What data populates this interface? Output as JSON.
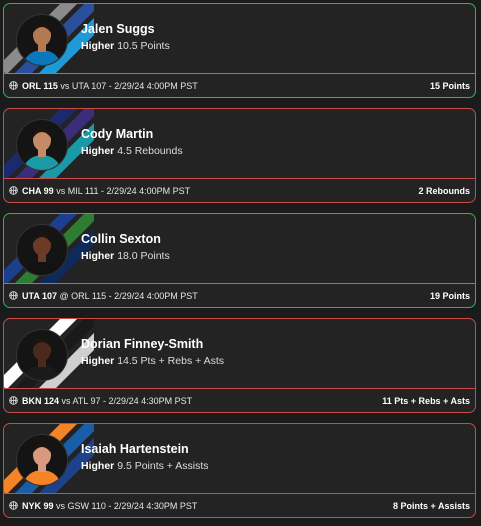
{
  "cards": [
    {
      "name": "Jalen Suggs",
      "direction": "Higher",
      "line": "10.5 Points",
      "game_team": "ORL 115",
      "game_rest": "vs UTA 107 - 2/29/24 4:00PM PST",
      "result": "15 Points",
      "outcome": "win",
      "stripe_colors": [
        "#8b8b8b",
        "#2a4f9b",
        "#1e9bd7"
      ],
      "skin": "#b27a52",
      "jersey": "#0b77bd"
    },
    {
      "name": "Cody Martin",
      "direction": "Higher",
      "line": "4.5 Rebounds",
      "game_team": "CHA 99",
      "game_rest": "vs MIL 111 - 2/29/24 4:00PM PST",
      "result": "2 Rebounds",
      "outcome": "loss",
      "stripe_colors": [
        "#1a2a6c",
        "#3a2d7a",
        "#1a9aa6"
      ],
      "skin": "#c58a66",
      "jersey": "#1a9aa6"
    },
    {
      "name": "Collin Sexton",
      "direction": "Higher",
      "line": "18.0 Points",
      "game_team": "UTA 107",
      "game_rest": "@ ORL 115 - 2/29/24 4:00PM PST",
      "result": "19 Points",
      "outcome": "win",
      "stripe_colors": [
        "#1c3f8f",
        "#2e7d33",
        "#0f2a5a"
      ],
      "skin": "#6b3b27",
      "jersey": "#121212"
    },
    {
      "name": "Dorian Finney-Smith",
      "direction": "Higher",
      "line": "14.5 Pts + Rebs + Asts",
      "game_team": "BKN 124",
      "game_rest": "vs ATL 97 - 2/29/24 4:30PM PST",
      "result": "11 Pts + Rebs + Asts",
      "outcome": "loss",
      "stripe_colors": [
        "#ffffff",
        "#1a1a1a",
        "#cfcfcf"
      ],
      "skin": "#4a2a1c",
      "jersey": "#1a1a1a"
    },
    {
      "name": "Isaiah Hartenstein",
      "direction": "Higher",
      "line": "9.5 Points + Assists",
      "game_team": "NYK 99",
      "game_rest": "vs GSW 110 - 2/29/24 4:30PM PST",
      "result": "8 Points + Assists",
      "outcome": "loss",
      "stripe_colors": [
        "#f58426",
        "#1a5ea8",
        "#1d428a"
      ],
      "skin": "#d79a80",
      "jersey": "#f58426"
    }
  ]
}
